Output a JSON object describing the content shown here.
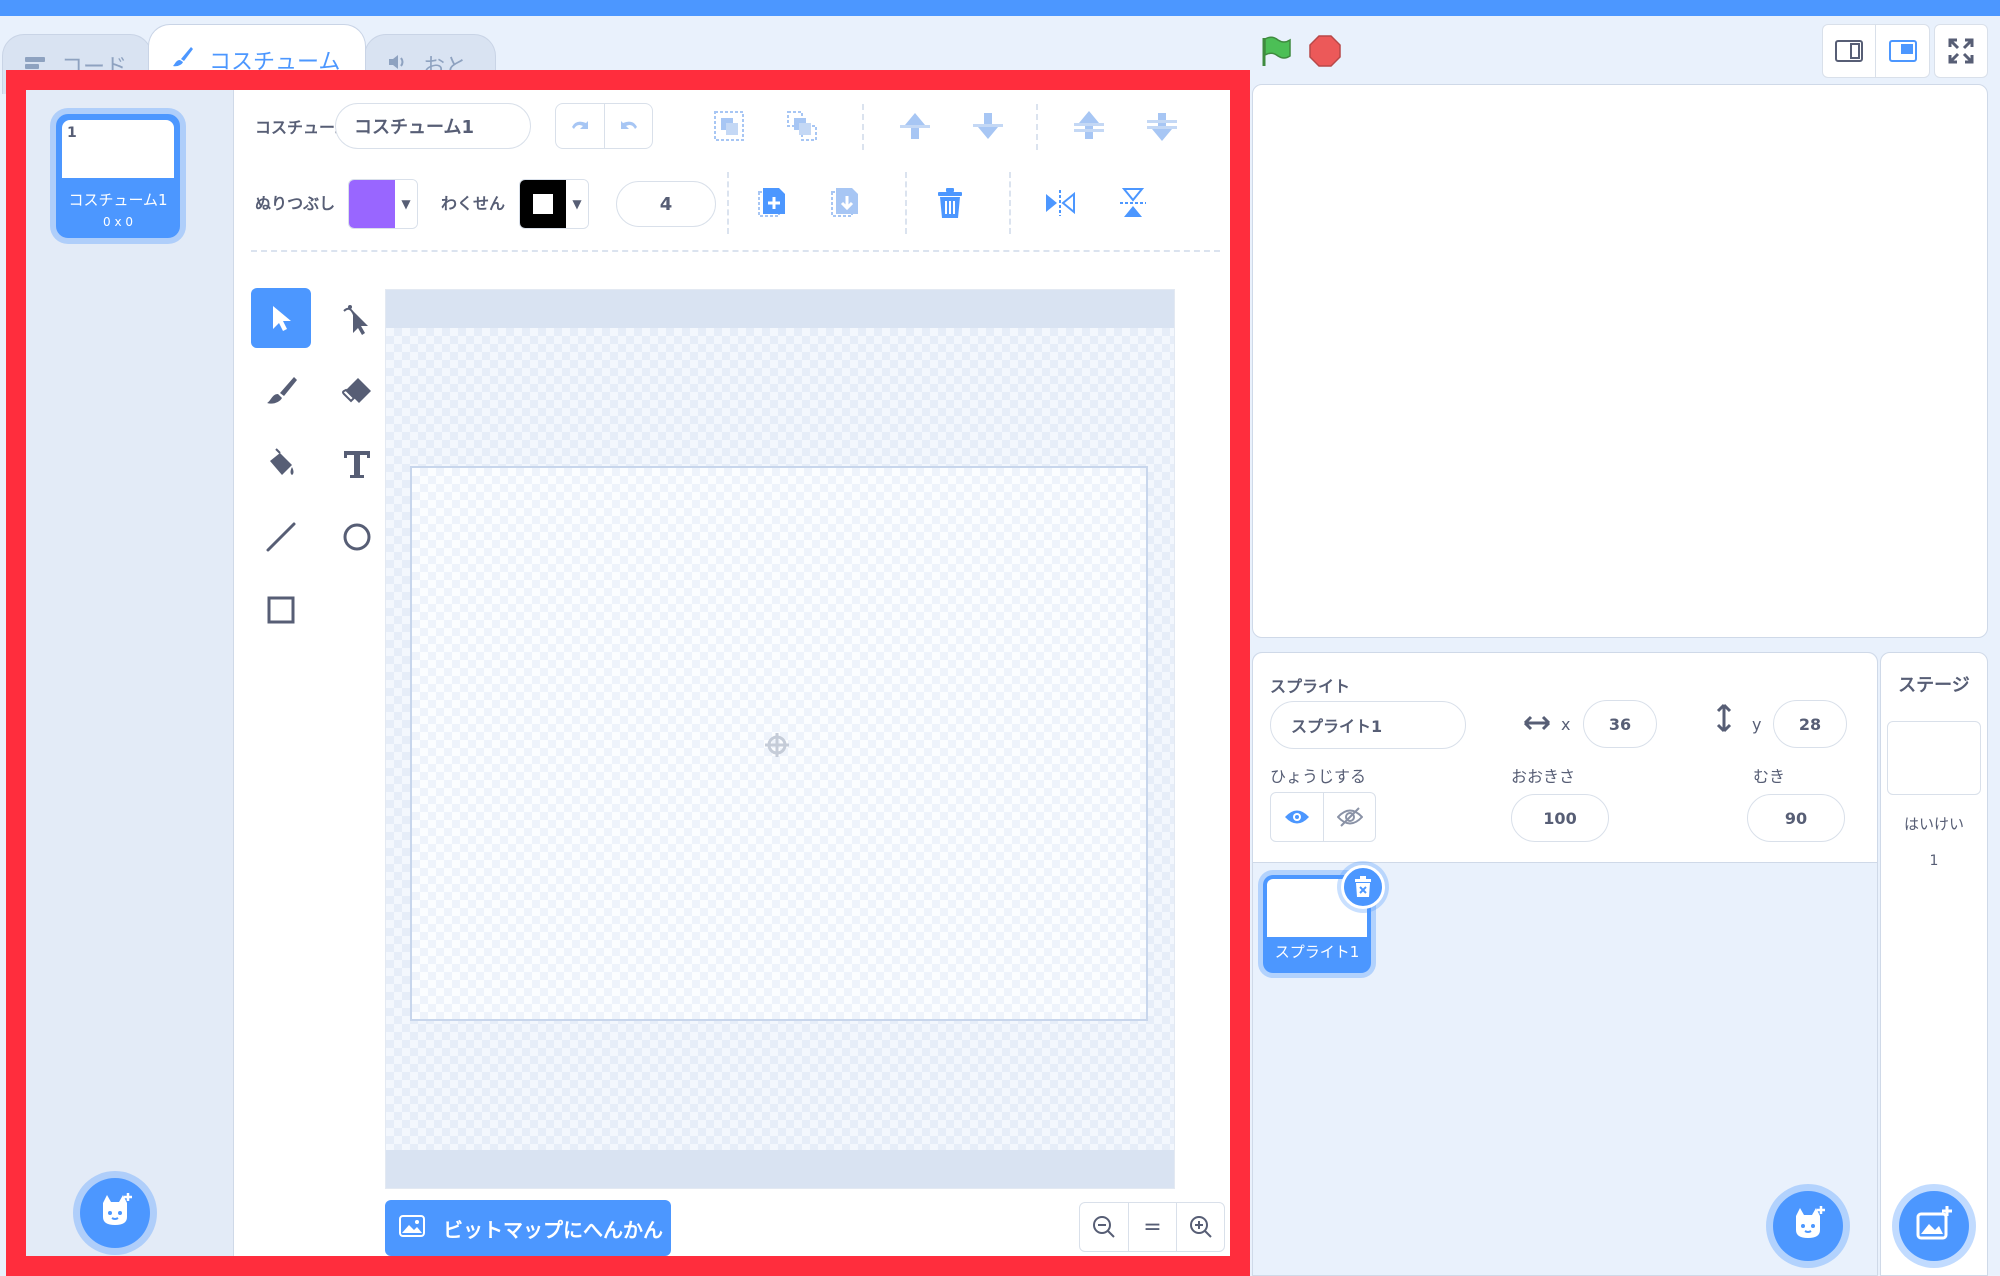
{
  "tabs": {
    "code": "コード",
    "costume": "コスチューム",
    "sound": "おと"
  },
  "costume_list": {
    "items": [
      {
        "number": "1",
        "name": "コスチューム1",
        "size": "0 x 0"
      }
    ]
  },
  "paint_editor": {
    "costume_label": "コスチューム",
    "costume_name": "コスチューム1",
    "fill_label": "ぬりつぶし",
    "fill_color": "#9966ff",
    "outline_label": "わくせん",
    "outline_color": "#000000",
    "outline_width": "4",
    "convert_button": "ビットマップにへんかん",
    "zoom_reset": "="
  },
  "sprite_info": {
    "sprite_label": "スプライト",
    "sprite_name": "スプライト1",
    "x_label": "x",
    "x_value": "36",
    "y_label": "y",
    "y_value": "28",
    "show_label": "ひょうじする",
    "size_label": "おおきさ",
    "size_value": "100",
    "direction_label": "むき",
    "direction_value": "90"
  },
  "sprites": [
    {
      "name": "スプライト1"
    }
  ],
  "stage_pane": {
    "title": "ステージ",
    "backdrop_label": "はいけい",
    "backdrop_count": "1"
  },
  "colors": {
    "accent": "#4c97ff",
    "highlight_border": "#ff2d3d",
    "green_flag": "#4cbf56",
    "stop": "#ec5959"
  }
}
